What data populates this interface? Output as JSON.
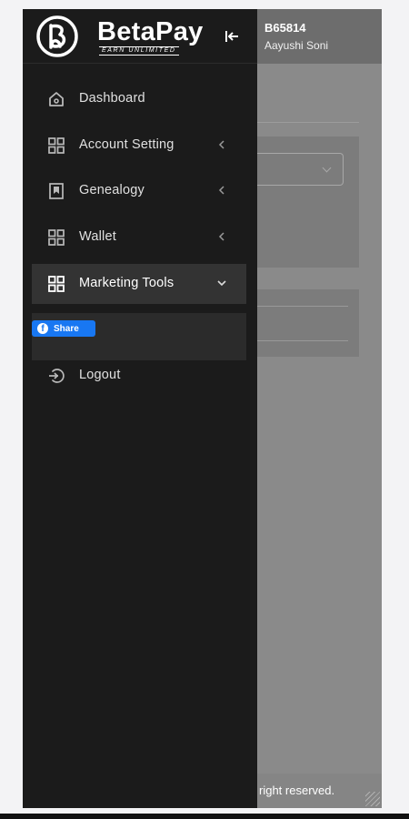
{
  "header": {
    "user_id": "B65814",
    "user_name": "Aayushi Soni"
  },
  "brand": {
    "name": "BetaPay",
    "tagline": "EARN UNLIMITED"
  },
  "sidebar": {
    "items": [
      {
        "label": "Dashboard",
        "icon": "home-icon",
        "has_submenu": false
      },
      {
        "label": "Account Setting",
        "icon": "grid-icon",
        "has_submenu": true
      },
      {
        "label": "Genealogy",
        "icon": "bookmark-icon",
        "has_submenu": true
      },
      {
        "label": "Wallet",
        "icon": "grid-icon",
        "has_submenu": true
      },
      {
        "label": "Marketing Tools",
        "icon": "grid-icon",
        "has_submenu": true,
        "expanded": true
      },
      {
        "label": "Logout",
        "icon": "logout-icon",
        "has_submenu": false
      }
    ],
    "submenu": {
      "share_label": "Share"
    }
  },
  "footer": {
    "text": "right reserved."
  },
  "colors": {
    "sidebar_bg": "#1b1b1b",
    "active_item_bg": "#333333",
    "facebook_blue": "#1877f2",
    "overlay_gray": "#8a8a8a"
  }
}
